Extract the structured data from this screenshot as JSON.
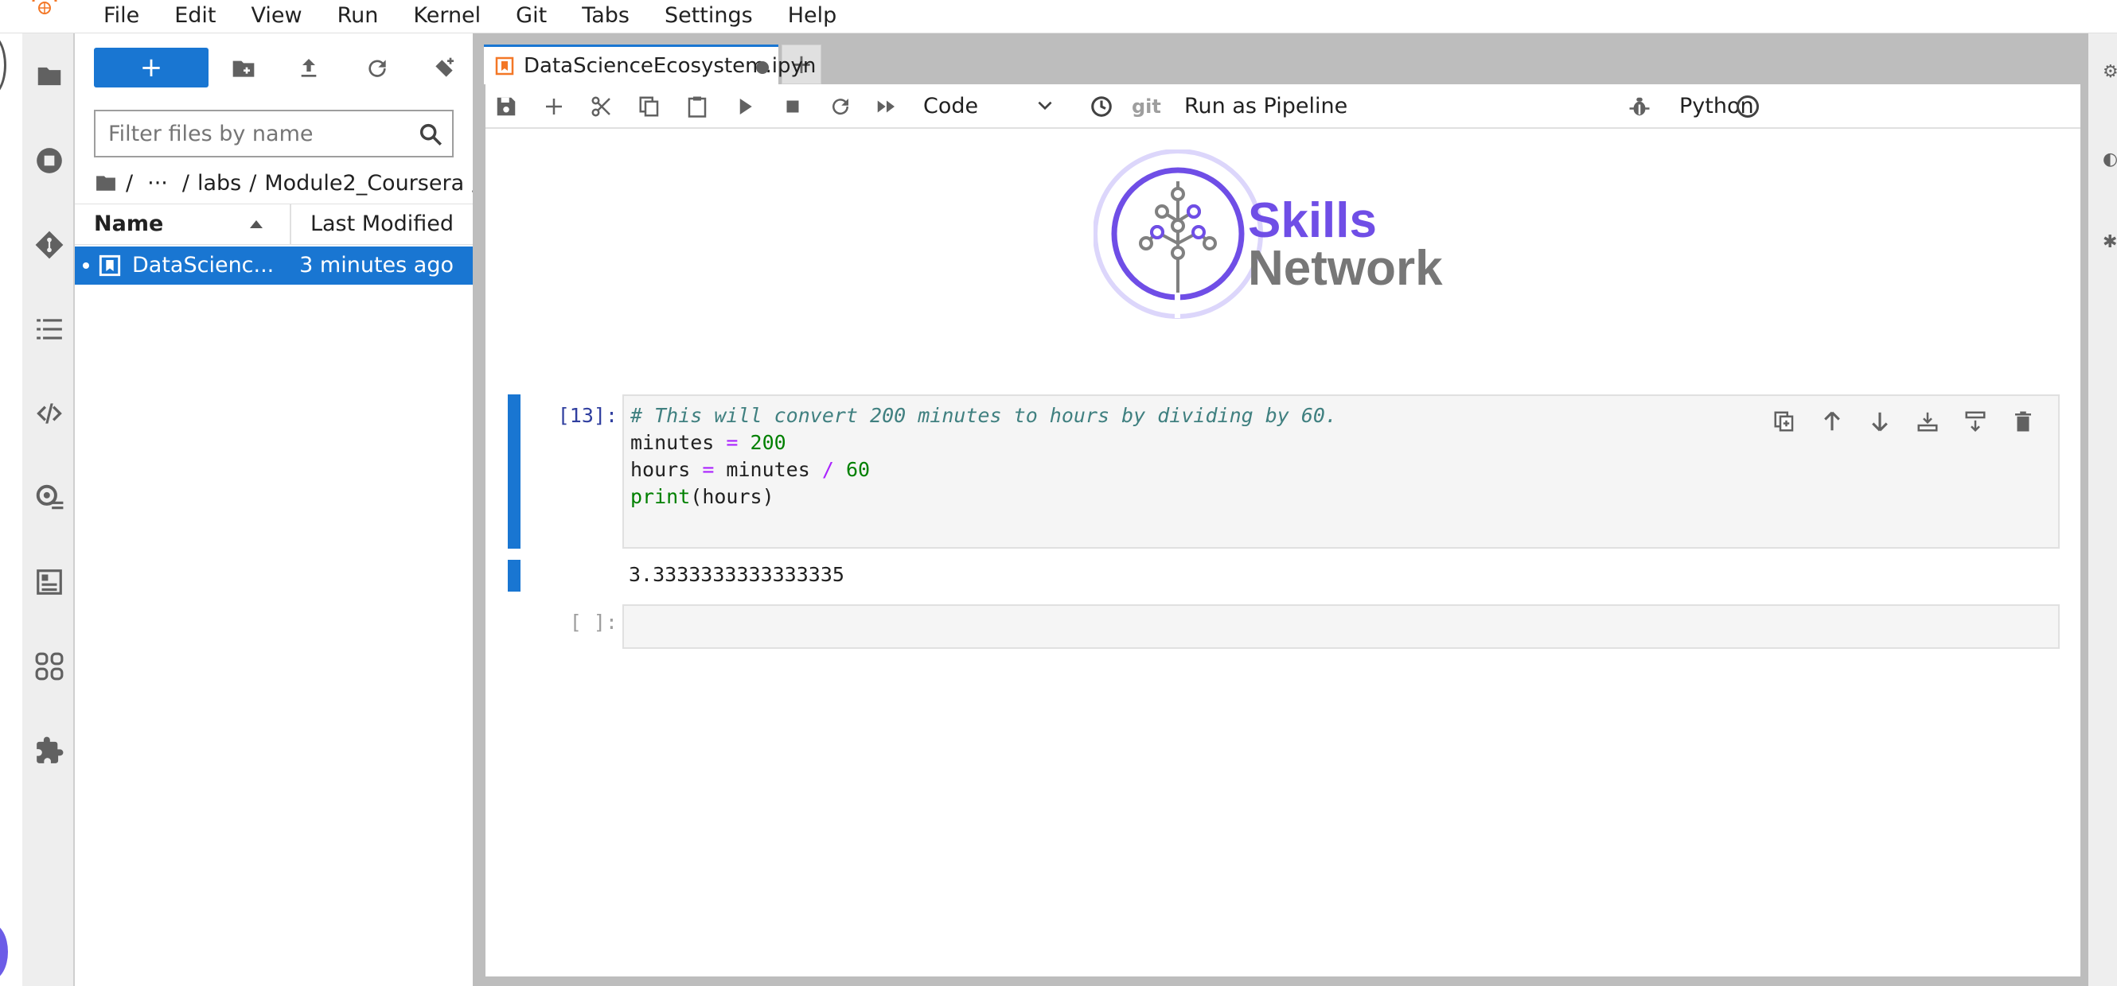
{
  "menu": {
    "items": [
      "File",
      "Edit",
      "View",
      "Run",
      "Kernel",
      "Git",
      "Tabs",
      "Settings",
      "Help"
    ]
  },
  "activity_bar": {
    "icons": [
      "folder-icon",
      "running-icon",
      "git-icon",
      "toc-icon",
      "code-snippet-icon",
      "property-inspector-icon",
      "runtimes-icon",
      "component-catalog-icon",
      "extension-icon"
    ]
  },
  "file_browser": {
    "new_button_label": "+",
    "filter_placeholder": "Filter files by name",
    "breadcrumbs": [
      "/",
      "···",
      "/",
      "labs",
      "/",
      "Module2_Coursera",
      "/"
    ],
    "columns": {
      "name": "Name",
      "modified": "Last Modified"
    },
    "files": [
      {
        "name": "DataScienc...",
        "modified": "3 minutes ago",
        "selected": true
      }
    ]
  },
  "tabs": {
    "active_tab": "DataScienceEcosystem.ipyn",
    "add_tab_label": "+"
  },
  "notebook_toolbar": {
    "cell_type": "Code",
    "git_label": "git",
    "run_pipeline_label": "Run as Pipeline",
    "kernel_name": "Python"
  },
  "notebook": {
    "logo": {
      "line1": "Skills",
      "line2": "Network",
      "primary_color": "#6f4ee6",
      "secondary_color": "#777777"
    },
    "cells": [
      {
        "prompt": "[13]:",
        "lines": [
          "# This will convert 200 minutes to hours by dividing by 60.",
          "minutes = 200",
          "hours = minutes / 60",
          "print(hours)"
        ],
        "output": "3.3333333333333335"
      },
      {
        "prompt": "[ ]:",
        "lines": []
      }
    ]
  },
  "colors": {
    "accent": "#1976d2",
    "code_comment": "#408080",
    "code_operator": "#aa22ff",
    "code_number": "#008000"
  }
}
